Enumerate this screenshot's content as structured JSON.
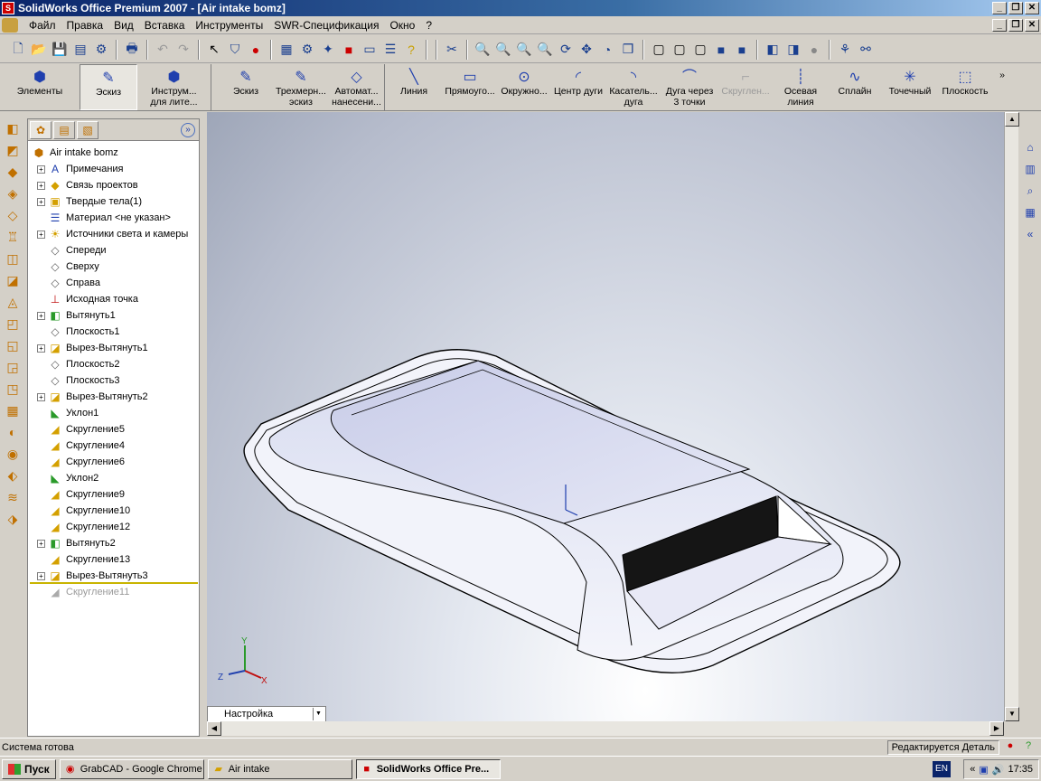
{
  "window": {
    "title": "SolidWorks Office Premium 2007 - [Air intake bomz]"
  },
  "menu": [
    "Файл",
    "Правка",
    "Вид",
    "Вставка",
    "Инструменты",
    "SWR-Спецификация",
    "Окно",
    "?"
  ],
  "command_manager": [
    {
      "label": "Элементы",
      "icon": "features-icon"
    },
    {
      "label": "Эскиз",
      "icon": "sketch-icon",
      "active": true
    },
    {
      "label": "Инструм... для лите...",
      "icon": "mold-tools-icon"
    },
    {
      "label": "Эскиз",
      "icon": "sketch-icon"
    },
    {
      "label": "Трехмерн... эскиз",
      "icon": "3d-sketch-icon"
    },
    {
      "label": "Автомат... нанесени...",
      "icon": "smart-dimension-icon"
    },
    {
      "label": "Линия",
      "icon": "line-icon"
    },
    {
      "label": "Прямоуго...",
      "icon": "rectangle-icon"
    },
    {
      "label": "Окружно...",
      "icon": "circle-icon"
    },
    {
      "label": "Центр дуги",
      "icon": "center-arc-icon"
    },
    {
      "label": "Касатель... дуга",
      "icon": "tangent-arc-icon"
    },
    {
      "label": "Дуга через 3 точки",
      "icon": "3point-arc-icon"
    },
    {
      "label": "Скруглен...",
      "icon": "sketch-fillet-icon",
      "disabled": true
    },
    {
      "label": "Осевая линия",
      "icon": "centerline-icon"
    },
    {
      "label": "Сплайн",
      "icon": "spline-icon"
    },
    {
      "label": "Точечный",
      "icon": "point-icon"
    },
    {
      "label": "Плоскость",
      "icon": "plane-icon"
    }
  ],
  "feature_tree": {
    "root": "Air intake bomz",
    "items": [
      {
        "label": "Примечания",
        "expandable": true,
        "icon": "annotations-icon"
      },
      {
        "label": "Связь проектов",
        "expandable": true,
        "icon": "design-binder-icon"
      },
      {
        "label": "Твердые тела(1)",
        "expandable": true,
        "icon": "solid-bodies-icon"
      },
      {
        "label": "Материал <не указан>",
        "expandable": false,
        "icon": "material-icon"
      },
      {
        "label": "Источники света и камеры",
        "expandable": true,
        "icon": "lights-icon"
      },
      {
        "label": "Спереди",
        "expandable": false,
        "icon": "plane-icon"
      },
      {
        "label": "Сверху",
        "expandable": false,
        "icon": "plane-icon"
      },
      {
        "label": "Справа",
        "expandable": false,
        "icon": "plane-icon"
      },
      {
        "label": "Исходная точка",
        "expandable": false,
        "icon": "origin-icon"
      },
      {
        "label": "Вытянуть1",
        "expandable": true,
        "icon": "extrude-icon"
      },
      {
        "label": "Плоскость1",
        "expandable": false,
        "icon": "plane-icon"
      },
      {
        "label": "Вырез-Вытянуть1",
        "expandable": true,
        "icon": "cut-extrude-icon"
      },
      {
        "label": "Плоскость2",
        "expandable": false,
        "icon": "plane-icon"
      },
      {
        "label": "Плоскость3",
        "expandable": false,
        "icon": "plane-icon"
      },
      {
        "label": "Вырез-Вытянуть2",
        "expandable": true,
        "icon": "cut-extrude-icon"
      },
      {
        "label": "Уклон1",
        "expandable": false,
        "icon": "draft-icon"
      },
      {
        "label": "Скругление5",
        "expandable": false,
        "icon": "fillet-icon"
      },
      {
        "label": "Скругление4",
        "expandable": false,
        "icon": "fillet-icon"
      },
      {
        "label": "Скругление6",
        "expandable": false,
        "icon": "fillet-icon"
      },
      {
        "label": "Уклон2",
        "expandable": false,
        "icon": "draft-icon"
      },
      {
        "label": "Скругление9",
        "expandable": false,
        "icon": "fillet-icon"
      },
      {
        "label": "Скругление10",
        "expandable": false,
        "icon": "fillet-icon"
      },
      {
        "label": "Скругление12",
        "expandable": false,
        "icon": "fillet-icon"
      },
      {
        "label": "Вытянуть2",
        "expandable": true,
        "icon": "extrude-icon"
      },
      {
        "label": "Скругление13",
        "expandable": false,
        "icon": "fillet-icon"
      },
      {
        "label": "Вырез-Вытянуть3",
        "expandable": true,
        "icon": "cut-extrude-icon"
      },
      {
        "label": "Скругление11",
        "expandable": false,
        "icon": "fillet-icon",
        "rolled_back": true
      }
    ]
  },
  "viewport": {
    "triad": {
      "x": "X",
      "y": "Y",
      "z": "Z"
    },
    "configuration_tab": "Настройка"
  },
  "statusbar": {
    "message": "Система готова",
    "mode": "Редактируется Деталь"
  },
  "taskbar": {
    "start": "Пуск",
    "tasks": [
      {
        "label": "GrabCAD - Google Chrome",
        "icon": "chrome-icon"
      },
      {
        "label": "Air intake",
        "icon": "folder-icon"
      },
      {
        "label": "SolidWorks Office Pre...",
        "icon": "solidworks-icon",
        "active": true
      }
    ],
    "language": "EN",
    "clock": "17:35"
  }
}
